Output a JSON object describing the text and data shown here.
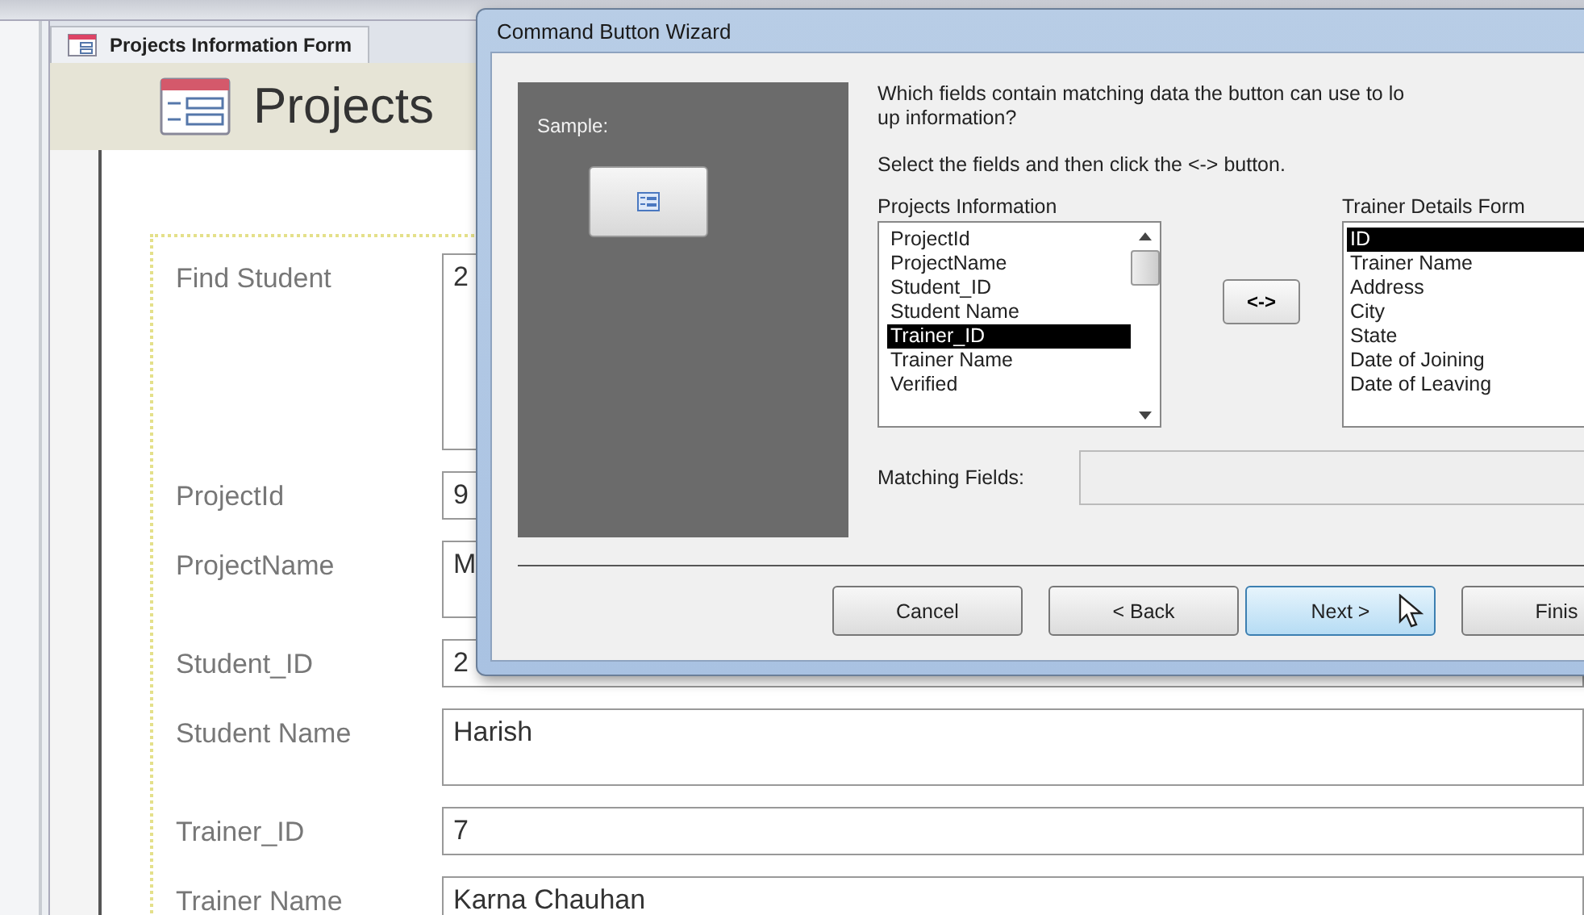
{
  "form": {
    "tab_title": "Projects Information Form",
    "header_title": "Projects",
    "fields": [
      {
        "label": "Find Student",
        "value": "2",
        "kind": "tall"
      },
      {
        "label": "ProjectId",
        "value": "9",
        "kind": "single"
      },
      {
        "label": "ProjectName",
        "value": "M",
        "kind": "multi"
      },
      {
        "label": "Student_ID",
        "value": "2",
        "kind": "single"
      },
      {
        "label": "Student Name",
        "value": "Harish",
        "kind": "multi"
      },
      {
        "label": "Trainer_ID",
        "value": "7",
        "kind": "single"
      },
      {
        "label": "Trainer Name",
        "value": "Karna Chauhan",
        "kind": "single"
      }
    ]
  },
  "dialog": {
    "title": "Command Button Wizard",
    "sample_label": "Sample:",
    "question_lines": [
      "Which fields contain matching data the button can use to lo",
      "up information?"
    ],
    "instruction": "Select the fields and then click the <-> button.",
    "left_list": {
      "title": "Projects Information",
      "items": [
        {
          "label": "ProjectId",
          "selected": false
        },
        {
          "label": "ProjectName",
          "selected": false
        },
        {
          "label": "Student_ID",
          "selected": false
        },
        {
          "label": "Student Name",
          "selected": false
        },
        {
          "label": "Trainer_ID",
          "selected": true
        },
        {
          "label": "Trainer Name",
          "selected": false
        },
        {
          "label": "Verified",
          "selected": false
        }
      ]
    },
    "swap_button": "<->",
    "right_list": {
      "title": "Trainer Details Form",
      "items": [
        {
          "label": "ID",
          "selected": true
        },
        {
          "label": "Trainer Name",
          "selected": false
        },
        {
          "label": "Address",
          "selected": false
        },
        {
          "label": "City",
          "selected": false
        },
        {
          "label": "State",
          "selected": false
        },
        {
          "label": "Date of Joining",
          "selected": false
        },
        {
          "label": "Date of Leaving",
          "selected": false
        }
      ]
    },
    "matching_label": "Matching Fields:",
    "buttons": [
      {
        "label": "Cancel",
        "default": false
      },
      {
        "label": "< Back",
        "default": false
      },
      {
        "label": "Next >",
        "default": true
      },
      {
        "label": "Finis",
        "default": false
      }
    ]
  }
}
